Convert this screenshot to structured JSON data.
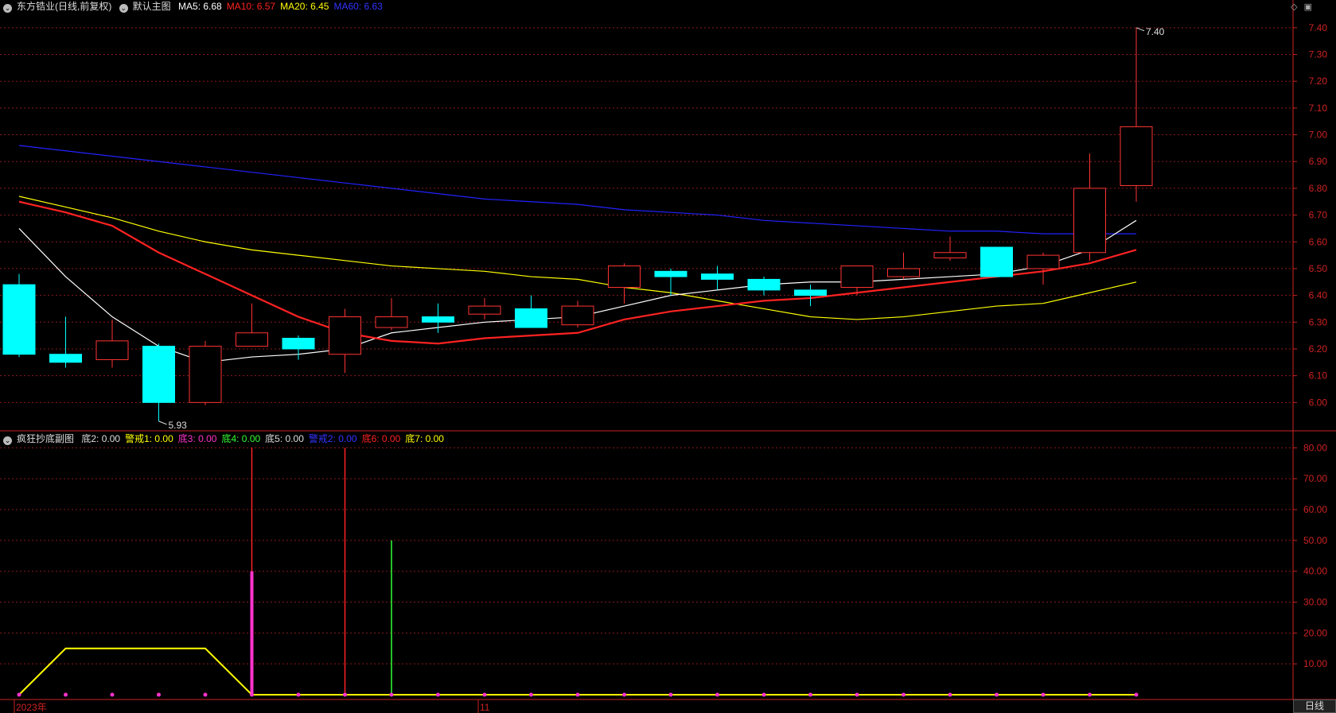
{
  "main_legend": {
    "stock": "东方锆业(日线,前复权)",
    "indicator": "默认主图",
    "items": [
      {
        "text": "MA5: 6.68",
        "color": "#ffffff"
      },
      {
        "text": "MA10: 6.57",
        "color": "#ff2222"
      },
      {
        "text": "MA20: 6.45",
        "color": "#ffff00"
      },
      {
        "text": "MA60: 6.63",
        "color": "#3333ff"
      }
    ]
  },
  "sub_legend": {
    "indicator": "疯狂抄底副图",
    "items": [
      {
        "text": "底2: 0.00",
        "color": "#dddddd"
      },
      {
        "text": "警戒1: 0.00",
        "color": "#ffff00"
      },
      {
        "text": "底3: 0.00",
        "color": "#ff33cc"
      },
      {
        "text": "底4: 0.00",
        "color": "#33ff33"
      },
      {
        "text": "底5: 0.00",
        "color": "#dddddd"
      },
      {
        "text": "警戒2: 0.00",
        "color": "#3333ff"
      },
      {
        "text": "底6: 0.00",
        "color": "#ff2222"
      },
      {
        "text": "底7: 0.00",
        "color": "#ffff00"
      }
    ]
  },
  "x_labels": [
    "2023年",
    "11"
  ],
  "day_button": "日线",
  "colors": {
    "up": "#ff3333",
    "down": "#00ffff",
    "grid": "#8b1a1a",
    "axis": "#cc2222",
    "ma5": "#ffffff",
    "ma10": "#ff2222",
    "ma20": "#ffff00",
    "ma60": "#2222ff"
  },
  "chart_data": [
    {
      "type": "candlestick",
      "title": "东方锆业(日线,前复权)",
      "ylim": [
        5.9,
        7.45
      ],
      "yticks": [
        6.0,
        6.1,
        6.2,
        6.3,
        6.4,
        6.5,
        6.6,
        6.7,
        6.8,
        6.9,
        7.0,
        7.1,
        7.2,
        7.3,
        7.4
      ],
      "candles": [
        {
          "o": 6.44,
          "c": 6.18,
          "h": 6.48,
          "l": 6.17
        },
        {
          "o": 6.18,
          "c": 6.15,
          "h": 6.32,
          "l": 6.13
        },
        {
          "o": 6.16,
          "c": 6.23,
          "h": 6.31,
          "l": 6.13
        },
        {
          "o": 6.21,
          "c": 6.0,
          "h": 6.22,
          "l": 5.93
        },
        {
          "o": 6.0,
          "c": 6.21,
          "h": 6.23,
          "l": 5.99
        },
        {
          "o": 6.21,
          "c": 6.26,
          "h": 6.37,
          "l": 6.21
        },
        {
          "o": 6.24,
          "c": 6.2,
          "h": 6.25,
          "l": 6.16
        },
        {
          "o": 6.18,
          "c": 6.32,
          "h": 6.35,
          "l": 6.11
        },
        {
          "o": 6.28,
          "c": 6.32,
          "h": 6.39,
          "l": 6.27
        },
        {
          "o": 6.32,
          "c": 6.3,
          "h": 6.37,
          "l": 6.26
        },
        {
          "o": 6.33,
          "c": 6.36,
          "h": 6.39,
          "l": 6.31
        },
        {
          "o": 6.35,
          "c": 6.28,
          "h": 6.4,
          "l": 6.28
        },
        {
          "o": 6.29,
          "c": 6.36,
          "h": 6.38,
          "l": 6.28
        },
        {
          "o": 6.43,
          "c": 6.51,
          "h": 6.52,
          "l": 6.37
        },
        {
          "o": 6.49,
          "c": 6.47,
          "h": 6.5,
          "l": 6.4
        },
        {
          "o": 6.48,
          "c": 6.46,
          "h": 6.51,
          "l": 6.42
        },
        {
          "o": 6.46,
          "c": 6.42,
          "h": 6.47,
          "l": 6.4
        },
        {
          "o": 6.42,
          "c": 6.4,
          "h": 6.44,
          "l": 6.36
        },
        {
          "o": 6.43,
          "c": 6.51,
          "h": 6.51,
          "l": 6.4
        },
        {
          "o": 6.47,
          "c": 6.5,
          "h": 6.56,
          "l": 6.46
        },
        {
          "o": 6.54,
          "c": 6.56,
          "h": 6.62,
          "l": 6.53
        },
        {
          "o": 6.58,
          "c": 6.47,
          "h": 6.58,
          "l": 6.47
        },
        {
          "o": 6.5,
          "c": 6.55,
          "h": 6.56,
          "l": 6.44
        },
        {
          "o": 6.56,
          "c": 6.8,
          "h": 6.93,
          "l": 6.53
        },
        {
          "o": 6.81,
          "c": 7.03,
          "h": 7.4,
          "l": 6.75
        }
      ],
      "ma5": [
        6.65,
        6.47,
        6.32,
        6.21,
        6.15,
        6.17,
        6.18,
        6.2,
        6.26,
        6.28,
        6.3,
        6.31,
        6.32,
        6.36,
        6.4,
        6.42,
        6.44,
        6.45,
        6.45,
        6.46,
        6.47,
        6.48,
        6.51,
        6.57,
        6.68
      ],
      "ma10": [
        6.75,
        6.71,
        6.66,
        6.56,
        6.48,
        6.4,
        6.32,
        6.26,
        6.23,
        6.22,
        6.24,
        6.25,
        6.26,
        6.31,
        6.34,
        6.36,
        6.38,
        6.39,
        6.41,
        6.43,
        6.45,
        6.47,
        6.49,
        6.52,
        6.57
      ],
      "ma20": [
        6.77,
        6.73,
        6.69,
        6.64,
        6.6,
        6.57,
        6.55,
        6.53,
        6.51,
        6.5,
        6.49,
        6.47,
        6.46,
        6.43,
        6.41,
        6.38,
        6.35,
        6.32,
        6.31,
        6.32,
        6.34,
        6.36,
        6.37,
        6.41,
        6.45
      ],
      "ma60": [
        6.96,
        6.94,
        6.92,
        6.9,
        6.88,
        6.86,
        6.84,
        6.82,
        6.8,
        6.78,
        6.76,
        6.75,
        6.74,
        6.72,
        6.71,
        6.7,
        6.68,
        6.67,
        6.66,
        6.65,
        6.64,
        6.64,
        6.63,
        6.63,
        6.63
      ],
      "annotations": [
        {
          "label": "7.40",
          "candle": 24,
          "value": 7.4
        },
        {
          "label": "5.93",
          "candle": 3,
          "value": 5.93
        }
      ]
    },
    {
      "type": "line",
      "title": "疯狂抄底副图",
      "ylim": [
        0,
        85
      ],
      "yticks": [
        10,
        20,
        30,
        40,
        50,
        60,
        70,
        80
      ],
      "series": [
        {
          "name": "警戒1",
          "color": "#ffff00",
          "values": [
            0,
            15,
            15,
            15,
            15,
            0,
            0,
            0,
            0,
            0,
            0,
            0,
            0,
            0,
            0,
            0,
            0,
            0,
            0,
            0,
            0,
            0,
            0,
            0,
            0
          ]
        },
        {
          "name": "底3",
          "color": "#ff33cc",
          "values": [
            0,
            0,
            0,
            0,
            0,
            40,
            0,
            0,
            0,
            0,
            0,
            0,
            0,
            0,
            0,
            0,
            0,
            0,
            0,
            0,
            0,
            0,
            0,
            0,
            0
          ]
        }
      ],
      "spikes": [
        {
          "candle": 5,
          "value": 80,
          "color": "#ff2222"
        },
        {
          "candle": 7,
          "value": 80,
          "color": "#ff2222"
        },
        {
          "candle": 8,
          "value": 50,
          "color": "#33ff33"
        }
      ],
      "dots": {
        "color": "#ff33cc",
        "value": 0
      }
    }
  ]
}
